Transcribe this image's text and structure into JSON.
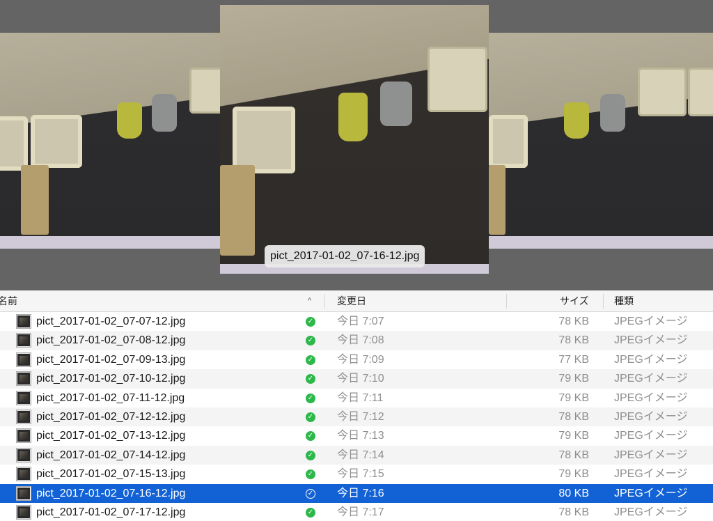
{
  "preview": {
    "caption": "pict_2017-01-02_07-16-12.jpg"
  },
  "list": {
    "columns": {
      "name": "名前",
      "sort_indicator": "^",
      "date": "変更日",
      "size": "サイズ",
      "kind": "種類"
    },
    "rows": [
      {
        "name": "pict_2017-01-02_07-07-12.jpg",
        "date": "今日 7:07",
        "size": "78 KB",
        "kind": "JPEGイメージ"
      },
      {
        "name": "pict_2017-01-02_07-08-12.jpg",
        "date": "今日 7:08",
        "size": "78 KB",
        "kind": "JPEGイメージ"
      },
      {
        "name": "pict_2017-01-02_07-09-13.jpg",
        "date": "今日 7:09",
        "size": "77 KB",
        "kind": "JPEGイメージ"
      },
      {
        "name": "pict_2017-01-02_07-10-12.jpg",
        "date": "今日 7:10",
        "size": "79 KB",
        "kind": "JPEGイメージ"
      },
      {
        "name": "pict_2017-01-02_07-11-12.jpg",
        "date": "今日 7:11",
        "size": "79 KB",
        "kind": "JPEGイメージ"
      },
      {
        "name": "pict_2017-01-02_07-12-12.jpg",
        "date": "今日 7:12",
        "size": "78 KB",
        "kind": "JPEGイメージ"
      },
      {
        "name": "pict_2017-01-02_07-13-12.jpg",
        "date": "今日 7:13",
        "size": "79 KB",
        "kind": "JPEGイメージ"
      },
      {
        "name": "pict_2017-01-02_07-14-12.jpg",
        "date": "今日 7:14",
        "size": "78 KB",
        "kind": "JPEGイメージ"
      },
      {
        "name": "pict_2017-01-02_07-15-13.jpg",
        "date": "今日 7:15",
        "size": "79 KB",
        "kind": "JPEGイメージ"
      },
      {
        "name": "pict_2017-01-02_07-16-12.jpg",
        "date": "今日 7:16",
        "size": "80 KB",
        "kind": "JPEGイメージ",
        "selected": true
      },
      {
        "name": "pict_2017-01-02_07-17-12.jpg",
        "date": "今日 7:17",
        "size": "78 KB",
        "kind": "JPEGイメージ"
      }
    ],
    "status_icon": "checkmark-circle-icon",
    "selection_color": "#1262d6",
    "status_color": "#2db84a"
  }
}
